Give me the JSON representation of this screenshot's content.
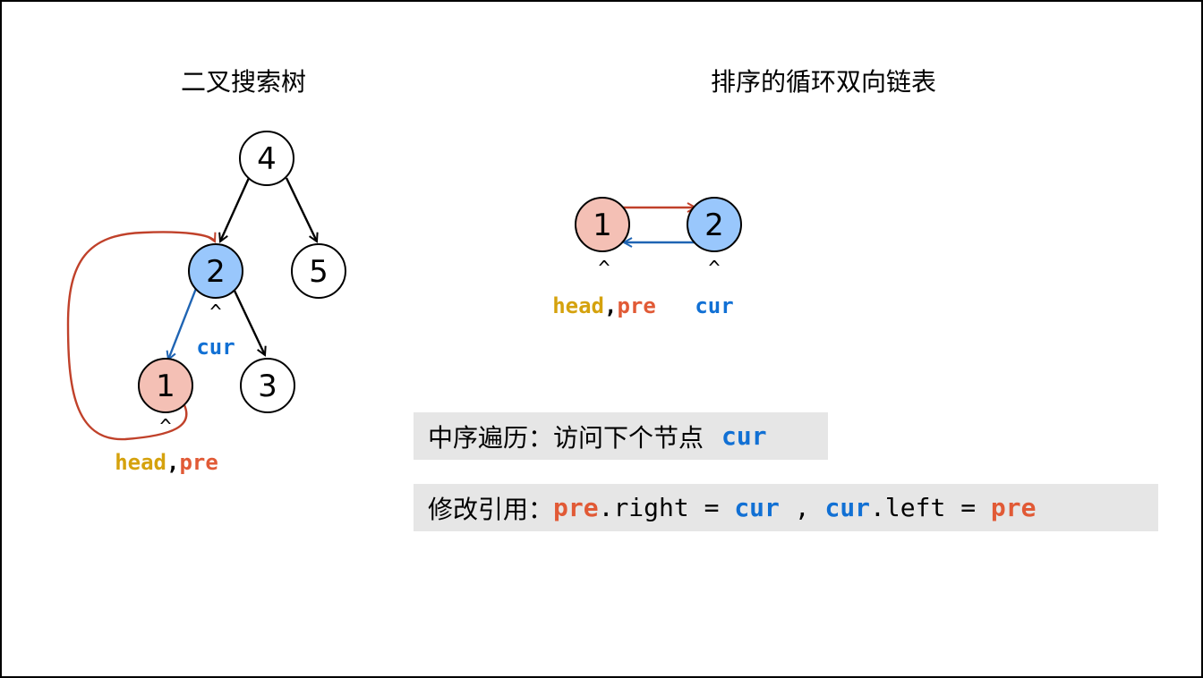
{
  "titles": {
    "bst": "二叉搜索树",
    "dll": "排序的循环双向链表"
  },
  "colors": {
    "node_default": "#FFFFFF",
    "node_cur": "#99C7FC",
    "node_pre": "#F4C0B5",
    "edge_tree": "#000000",
    "edge_red": "#C0412A",
    "edge_blue": "#1F64B3",
    "text_head": "#D5A20D",
    "text_pre": "#E15A36",
    "text_cur": "#1170D4",
    "step_bg": "#E6E6E6"
  },
  "tree": {
    "nodes": [
      {
        "id": "n4",
        "label": "4",
        "state": "default"
      },
      {
        "id": "n2",
        "label": "2",
        "state": "cur"
      },
      {
        "id": "n5",
        "label": "5",
        "state": "default"
      },
      {
        "id": "n1",
        "label": "1",
        "state": "pre"
      },
      {
        "id": "n3",
        "label": "3",
        "state": "default"
      }
    ],
    "edges": [
      {
        "from": "n4",
        "to": "n2"
      },
      {
        "from": "n4",
        "to": "n5"
      },
      {
        "from": "n2",
        "to": "n1"
      },
      {
        "from": "n2",
        "to": "n3"
      }
    ],
    "cur_pointer": {
      "caret": "^",
      "label": "cur"
    },
    "pre_pointer": {
      "caret": "^",
      "head": "head",
      "comma": ",",
      "pre": "pre"
    }
  },
  "list": {
    "nodes": [
      {
        "id": "l1",
        "label": "1",
        "state": "pre"
      },
      {
        "id": "l2",
        "label": "2",
        "state": "cur"
      }
    ],
    "pointers": {
      "left_caret": "^",
      "head": "head",
      "comma": ",",
      "pre": "pre",
      "right_caret": "^",
      "cur": "cur"
    }
  },
  "steps": {
    "visit": {
      "label": "中序遍历：访问下个节点",
      "cur": "cur"
    },
    "link": {
      "label": "修改引用：",
      "pre1": "pre",
      "right_part": ".right = ",
      "cur1": "cur",
      "sep": " , ",
      "cur2": "cur",
      "left_part": ".left = ",
      "pre2": "pre"
    }
  }
}
